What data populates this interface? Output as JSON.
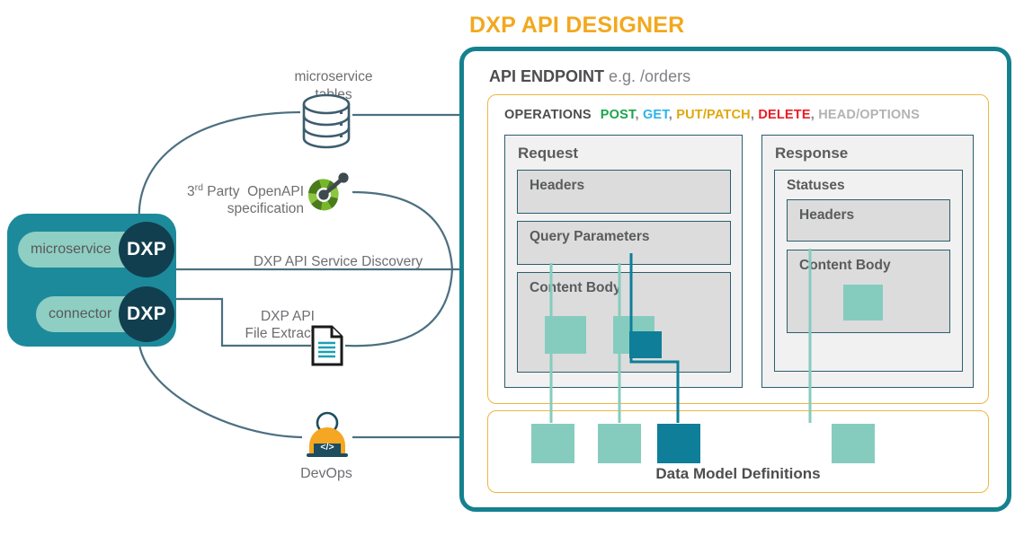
{
  "diagram": {
    "title": "DXP API DESIGNER",
    "accent_orange": "#f2a81d",
    "accent_teal": "#15818f",
    "mint": "#85ccbf",
    "dark_teal": "#0e7e99",
    "navy": "#123f4f"
  },
  "source": {
    "microservice_pill": "microservice",
    "connector_pill": "connector",
    "dxp_badge_1": "DXP",
    "dxp_badge_2": "DXP"
  },
  "inputs": [
    {
      "id": "microservice-tables",
      "label_line1": "microservice",
      "label_line2": "tables",
      "icon": "database-icon"
    },
    {
      "id": "openapi-spec",
      "label_line1": "3rd Party  OpenAPI",
      "label_line2": "specification",
      "icon": "openapi-icon"
    },
    {
      "id": "service-discovery",
      "label": "DXP API Service Discovery",
      "icon": "none"
    },
    {
      "id": "file-extract",
      "label_line1": "DXP API",
      "label_line2": "File Extract",
      "icon": "document-icon"
    },
    {
      "id": "devops",
      "label": "DevOps",
      "icon": "devops-person-icon"
    }
  ],
  "endpoint": {
    "heading_bold": "API ENDPOINT",
    "heading_example": "e.g. /orders"
  },
  "operations": {
    "label": "OPERATIONS",
    "verbs": [
      {
        "name": "POST",
        "color": "#1aa44b"
      },
      {
        "name": "GET",
        "color": "#2bb3ea"
      },
      {
        "name": "PUT/PATCH",
        "color": "#e0a80c"
      },
      {
        "name": "DELETE",
        "color": "#ec1c24"
      },
      {
        "name": "HEAD/OPTIONS",
        "color": "#b1b3b5"
      }
    ],
    "separator": ","
  },
  "request": {
    "title": "Request",
    "boxes": [
      {
        "id": "req-headers",
        "title": "Headers"
      },
      {
        "id": "req-query",
        "title": "Query Parameters"
      },
      {
        "id": "req-content",
        "title": "Content Body"
      }
    ]
  },
  "response": {
    "title": "Response",
    "statuses_title": "Statuses",
    "boxes": [
      {
        "id": "res-headers",
        "title": "Headers"
      },
      {
        "id": "res-content",
        "title": "Content Body"
      }
    ]
  },
  "data_models": {
    "label": "Data Model Definitions",
    "squares": [
      {
        "id": "model-1",
        "color": "mint"
      },
      {
        "id": "model-2",
        "color": "mint"
      },
      {
        "id": "model-3",
        "color": "dark"
      },
      {
        "id": "model-4",
        "color": "mint"
      }
    ]
  }
}
